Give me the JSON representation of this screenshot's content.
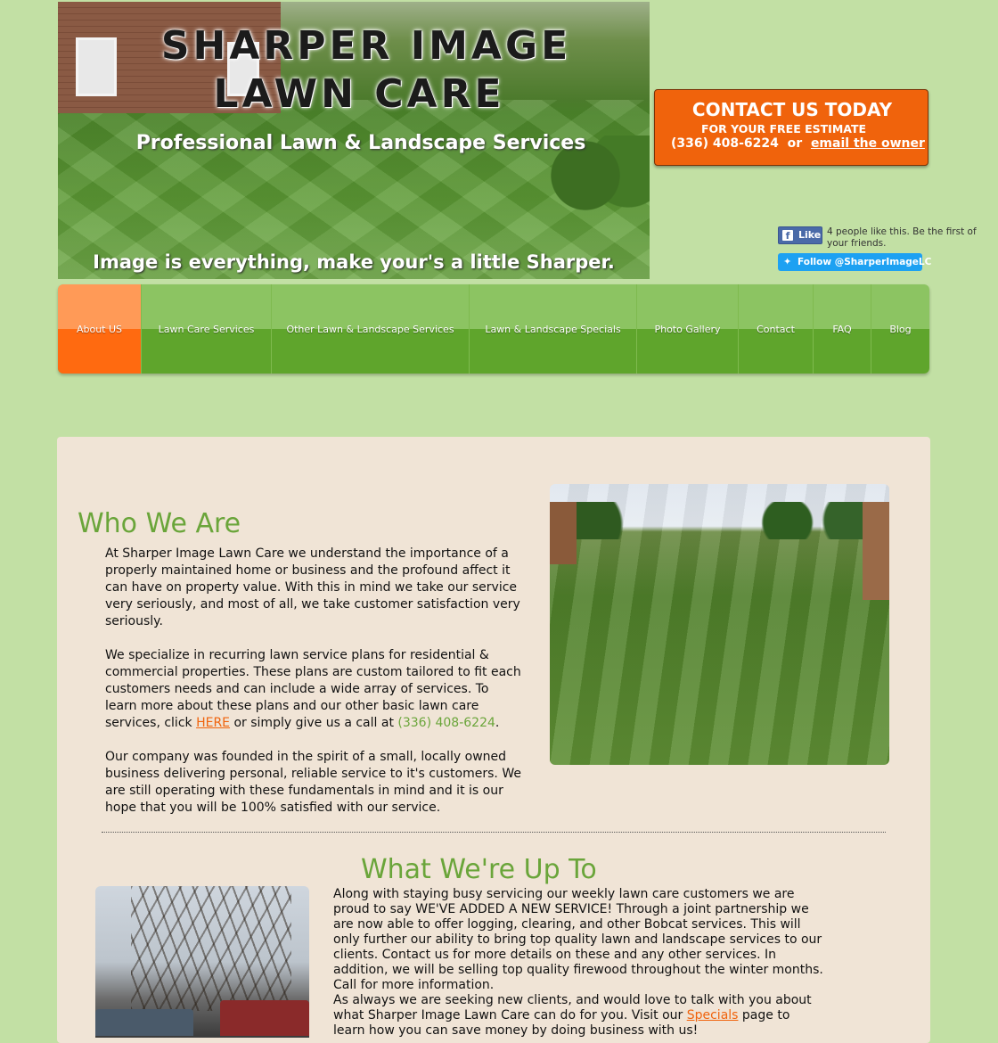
{
  "header": {
    "title_line1": "SHARPER IMAGE",
    "title_line2": "LAWN CARE",
    "subtitle": "Professional Lawn & Landscape Services",
    "tagline": "Image is everything, make your's  a little Sharper."
  },
  "contact": {
    "heading": "CONTACT US TODAY",
    "subheading": "FOR YOUR FREE ESTIMATE",
    "phone": "(336) 408-6224",
    "separator": "or",
    "email_link": "email the owner"
  },
  "social": {
    "fb_button": "Like",
    "fb_icon": "f",
    "fb_text": "4 people like this. Be the first of your friends.",
    "twitter_button": "Follow @SharperImageLC",
    "twitter_icon": "bird-icon"
  },
  "nav": {
    "items": [
      {
        "label": "About US",
        "active": true
      },
      {
        "label": "Lawn Care Services"
      },
      {
        "label": "Other Lawn & Landscape Services"
      },
      {
        "label": "Lawn & Landscape Specials"
      },
      {
        "label": "Photo Gallery"
      },
      {
        "label": "Contact"
      },
      {
        "label": "FAQ"
      },
      {
        "label": "Blog"
      }
    ]
  },
  "who": {
    "heading": "Who We Are",
    "p1": "At Sharper Image Lawn Care we understand the importance of a properly maintained home or business and the profound affect it can have on property value. With this in mind we take our service very seriously, and most of all, we take customer satisfaction very seriously.",
    "p2_before": "We specialize in recurring lawn service plans for residential & commercial properties. These plans are custom tailored to fit each customers needs and can include a wide array of services. To learn more about these plans and our other basic lawn care services, click ",
    "p2_link": "HERE",
    "p2_middle": " or simply give us a call at ",
    "p2_phone": "(336) 408-6224",
    "p2_after": ".",
    "p3": "Our company was founded in the spirit of a small, locally owned business delivering personal, reliable service to it's customers. We are still operating with these fundamentals in mind and it is our hope that you will be 100% satisfied with our service."
  },
  "what": {
    "heading": "What We're Up To",
    "p1": "Along with staying busy servicing our weekly lawn care customers we are proud to say WE'VE ADDED A NEW SERVICE! Through a joint partnership we are now able to offer logging, clearing, and other Bobcat services. This will only further our ability to bring top quality lawn and landscape services to our clients. Contact us for more details on these and any other services. In addition, we will be selling top quality firewood throughout the winter months. Call for more information.",
    "p2_before": "As always we are seeking new clients, and would love to talk with you about what Sharper Image Lawn Care can do for you. Visit our ",
    "p2_link": "Specials",
    "p2_after": " page to learn how you can save money by doing business with us!"
  },
  "colors": {
    "background": "#c2e0a4",
    "accent_orange": "#f0630c",
    "heading_green": "#6aa53a",
    "nav_green": "#5fa52c",
    "panel": "#f0e4d6"
  }
}
